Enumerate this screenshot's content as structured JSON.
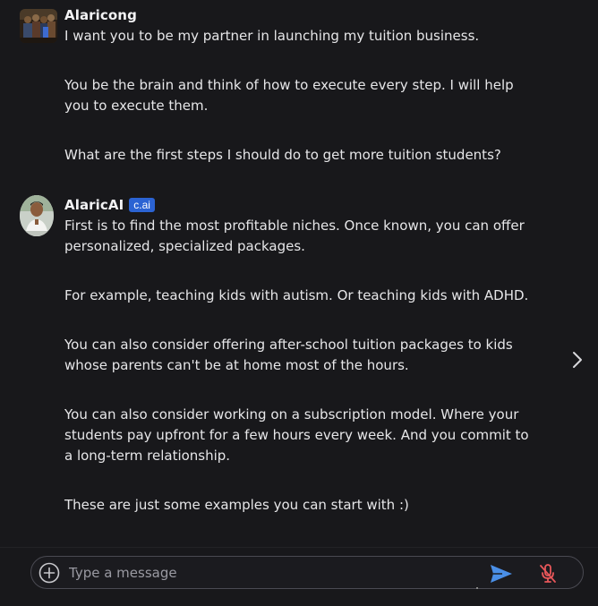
{
  "messages": [
    {
      "author": "Alaricong",
      "badge": "",
      "paragraphs": [
        "I want you to be my partner in launching my tuition business.",
        "You be the brain and think of how to execute every step. I will help you to execute them.",
        "What are the first steps I should do to get more tuition students?"
      ]
    },
    {
      "author": "AlaricAI",
      "badge": "c.ai",
      "paragraphs": [
        "First is to find the most profitable niches. Once known, you can offer personalized, specialized packages.",
        "For example, teaching kids with autism. Or teaching kids with ADHD.",
        "You can also consider offering after-school tuition packages to kids whose parents can't be at home most of the hours.",
        "You can also consider working on a subscription model. Where your students pay upfront for a few hours every week. And you commit to a long-term relationship.",
        "These are just some examples you can start with :)"
      ]
    }
  ],
  "composer": {
    "placeholder": "Type a message"
  },
  "icons": {
    "add": "plus-circle-icon",
    "send": "send-icon",
    "mic": "mic-off-icon",
    "next": "chevron-right-icon"
  },
  "colors": {
    "background": "#18181b",
    "badge": "#2b63d3",
    "send": "#4a8fe7",
    "mic_muted": "#e8575a"
  }
}
